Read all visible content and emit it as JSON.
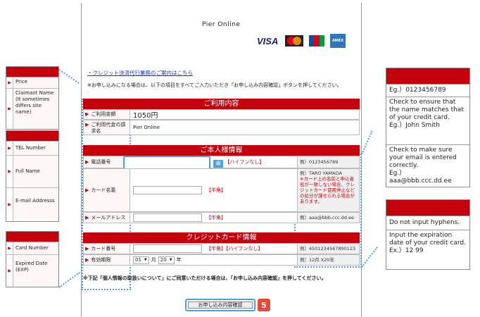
{
  "header": {
    "title": "Pier  Online",
    "cards": [
      "VISA",
      "MasterCard",
      "JCB",
      "AMEX"
    ]
  },
  "links": {
    "notice": "・クレジット決済代行業務のご案内はこちら"
  },
  "intro": "※お申し込みになる場合は、以下の項目をすべてご入力いただき「お申し込み内容確認」ボタンを押してください。",
  "sections": {
    "usage": "ご利用内容",
    "personal": "ご本人様情報",
    "card": "クレジットカード情報"
  },
  "usage": {
    "amount_label": "ご利用金額",
    "amount_value": "1050円",
    "claimant_label": "ご利用代金の請求名",
    "claimant_value": "Pier  Online"
  },
  "personal": {
    "tel_label": "電話番号",
    "tel_note": "【ハイフンなし】",
    "tel_example": "例）0123456789",
    "name_label": "カード名義",
    "name_note": "【半角】",
    "name_example": "例）TARO YAMADA",
    "name_example_warning": "※カード上の名前と申込者名が一致しない場合、クレジットカード使用停止などの処分が課せられる場合があります。",
    "mail_label": "メールアドレス",
    "mail_note": "【半角】",
    "mail_example": "例）aaa@bbb.ccc.dd.ee",
    "kome": "※"
  },
  "card": {
    "number_label": "カード番号",
    "number_note": "【半角】【ハイフンなし】",
    "number_example": "例）4501234567890123",
    "exp_label": "有効期限",
    "month": "01",
    "month_unit": "月",
    "year": "20",
    "year_unit": "年",
    "exp_example": "例）12月 X20年"
  },
  "consent": "※下記「個人情報の取扱いについて」にご同意いただける場合は、「お申し込み内容確認」を押してください。",
  "confirm_button": "お申し込み内容確認",
  "step_badge": "5",
  "left_panel": {
    "box1": [
      "Price",
      "Claimant Name (It sometimes differs site name)"
    ],
    "box2": [
      "TEL Number",
      "Full Name",
      "E-mail Addresss"
    ],
    "box3": [
      "Card Number",
      "Expired Date (EXP)"
    ]
  },
  "right_panel": {
    "box1": [
      "Eg.）0123456789",
      "Check to ensure that the name matches that of your credit card.\nEg.）John Smith",
      "Check to make sure your email is entered correctly.\nEg.）aaa@bbb.ccc.dd.ee"
    ],
    "box2": [
      "Do not input hyphens.",
      "Input the expiration date of your credit card.\nEx.）12 99"
    ]
  },
  "colors": {
    "accent": "#c4000d",
    "callout": "#4aa3df"
  }
}
